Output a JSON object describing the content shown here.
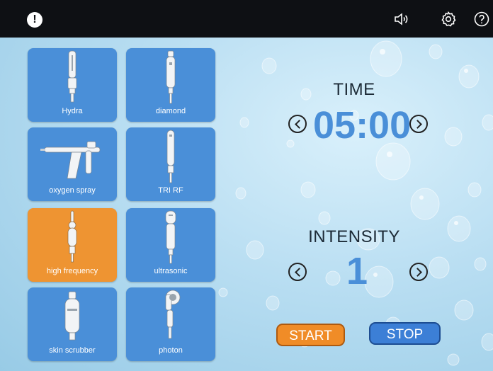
{
  "topbar": {
    "alert_symbol": "!",
    "icons": [
      "alert-icon",
      "speaker-icon",
      "gear-icon",
      "help-icon"
    ]
  },
  "handpieces": [
    {
      "label": "Hydra",
      "icon": "hydra-handpiece-icon",
      "selected": false
    },
    {
      "label": "diamond",
      "icon": "diamond-handpiece-icon",
      "selected": false
    },
    {
      "label": "oxygen spray",
      "icon": "spray-gun-icon",
      "selected": false
    },
    {
      "label": "TRI RF",
      "icon": "rf-handpiece-icon",
      "selected": false
    },
    {
      "label": "high frequency",
      "icon": "high-frequency-wand-icon",
      "selected": true
    },
    {
      "label": "ultrasonic",
      "icon": "ultrasonic-handpiece-icon",
      "selected": false
    },
    {
      "label": "skin scrubber",
      "icon": "skin-scrubber-icon",
      "selected": false
    },
    {
      "label": "photon",
      "icon": "photon-handpiece-icon",
      "selected": false
    }
  ],
  "time": {
    "label": "TIME",
    "value": "05:00"
  },
  "intensity": {
    "label": "INTENSITY",
    "value": "1"
  },
  "actions": {
    "start": "START",
    "stop": "STOP"
  },
  "colors": {
    "tile": "#4a8fd8",
    "tile_selected": "#ee9432",
    "value": "#4a8fd8",
    "start": "#f08c27",
    "stop": "#3c7fd6"
  }
}
